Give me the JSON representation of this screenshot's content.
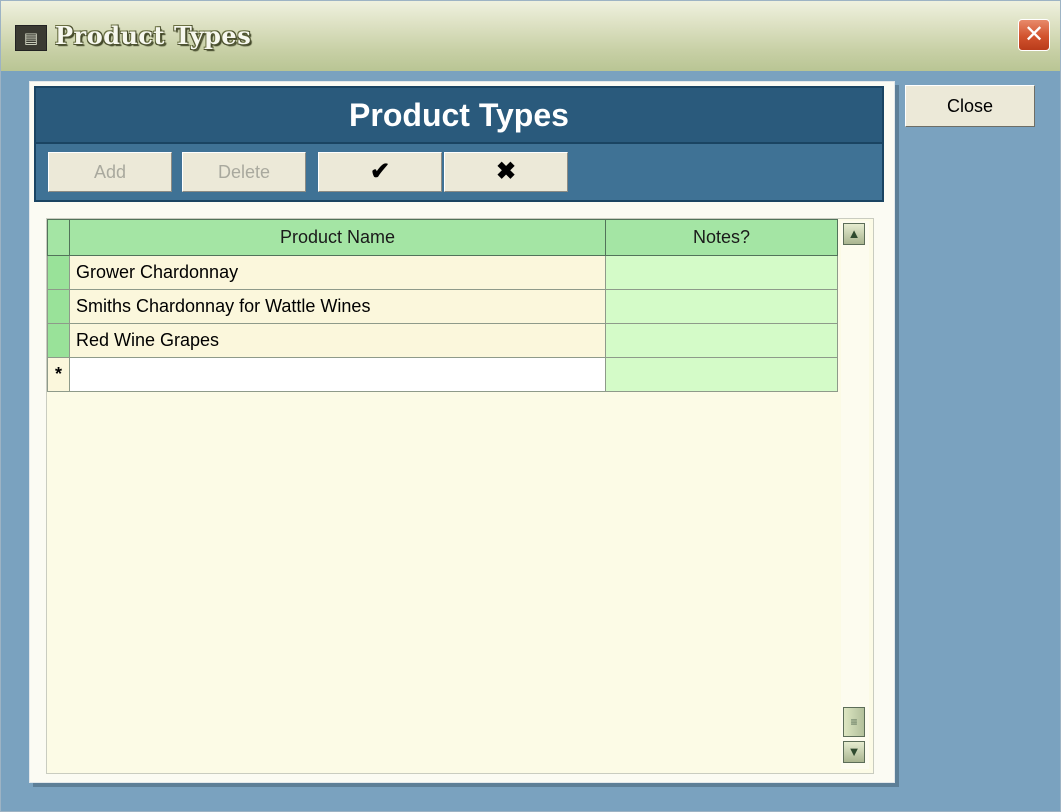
{
  "window": {
    "title": "Product Types",
    "app_icon": "app-icon",
    "close_glyph": "✕"
  },
  "form": {
    "header_title": "Product Types",
    "toolbar": {
      "add_label": "Add",
      "delete_label": "Delete",
      "accept_glyph": "✔",
      "cancel_glyph": "✖"
    },
    "close_button_label": "Close"
  },
  "grid": {
    "columns": [
      "Product Name",
      "Notes?"
    ],
    "rows": [
      {
        "name": "Grower Chardonnay",
        "notes": ""
      },
      {
        "name": "Smiths Chardonnay for Wattle Wines",
        "notes": ""
      },
      {
        "name": "Red Wine Grapes",
        "notes": ""
      }
    ],
    "new_row_marker": "*"
  },
  "colors": {
    "header_bg": "#2a5a7c",
    "toolbar_bg": "#3f7295",
    "grid_header_bg": "#a4e5a4",
    "notes_cell_bg": "#d4fbc8",
    "window_bg": "#7aa2bf"
  }
}
